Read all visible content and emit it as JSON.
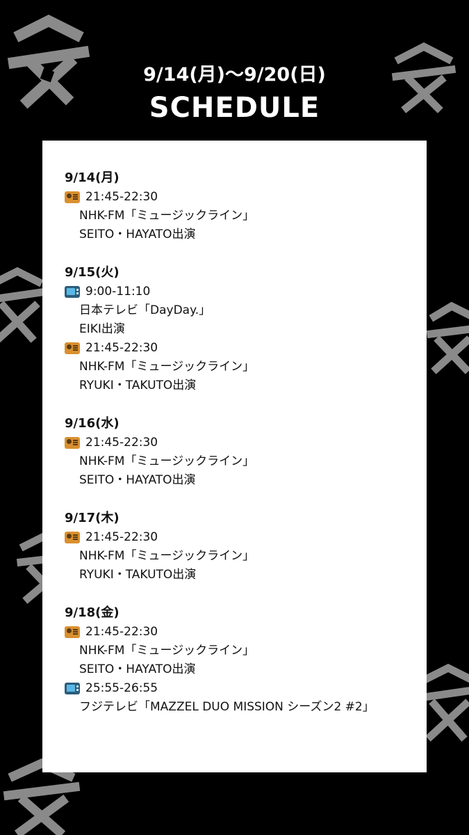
{
  "header": {
    "date_range": "9/14(月)〜9/20(日)",
    "title": "SCHEDULE"
  },
  "schedule": [
    {
      "date": "9/14(月)",
      "entries": [
        {
          "icon": "radio-icon",
          "time": "21:45-22:30",
          "program": "NHK-FM「ミュージックライン」",
          "cast": "SEITO・HAYATO出演"
        }
      ]
    },
    {
      "date": "9/15(火)",
      "entries": [
        {
          "icon": "tv-icon",
          "time": "9:00-11:10",
          "program": "日本テレビ「DayDay.」",
          "cast": "EIKI出演"
        },
        {
          "icon": "radio-icon",
          "time": "21:45-22:30",
          "program": "NHK-FM「ミュージックライン」",
          "cast": "RYUKI・TAKUTO出演"
        }
      ]
    },
    {
      "date": "9/16(水)",
      "entries": [
        {
          "icon": "radio-icon",
          "time": "21:45-22:30",
          "program": "NHK-FM「ミュージックライン」",
          "cast": "SEITO・HAYATO出演"
        }
      ]
    },
    {
      "date": "9/17(木)",
      "entries": [
        {
          "icon": "radio-icon",
          "time": "21:45-22:30",
          "program": "NHK-FM「ミュージックライン」",
          "cast": "RYUKI・TAKUTO出演"
        }
      ]
    },
    {
      "date": "9/18(金)",
      "entries": [
        {
          "icon": "radio-icon",
          "time": "21:45-22:30",
          "program": "NHK-FM「ミュージックライン」",
          "cast": "SEITO・HAYATO出演"
        },
        {
          "icon": "tv-icon",
          "time": "25:55-26:55",
          "program": "フジテレビ「MAZZEL DUO MISSION シーズン2 #2」",
          "cast": ""
        }
      ]
    }
  ],
  "colors": {
    "background": "#000000",
    "card": "#ffffff",
    "decoration": "#8a8a8a",
    "text": "#111111"
  }
}
